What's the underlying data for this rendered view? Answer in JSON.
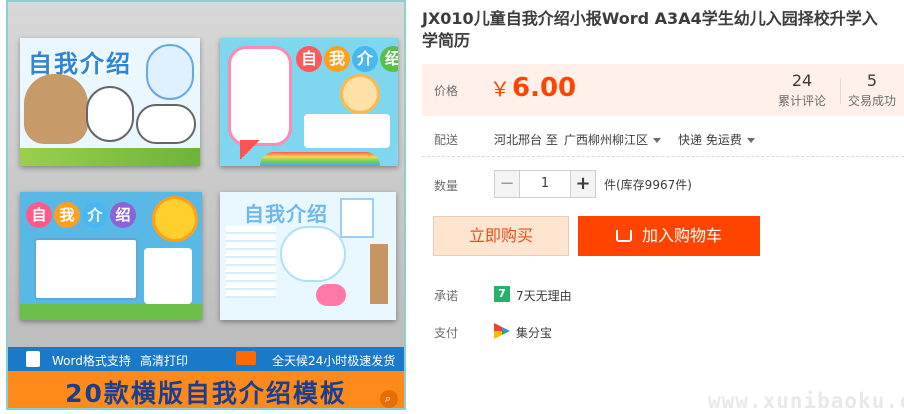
{
  "gallery": {
    "card1_title": "自我介绍",
    "card2_title_chars": [
      "自",
      "我",
      "介",
      "绍"
    ],
    "card2_title_colors": [
      "#ff5a5a",
      "#ff9f1a",
      "#49b8f0",
      "#58c04a"
    ],
    "card3_title_chars": [
      "自",
      "我",
      "介",
      "绍"
    ],
    "card3_title_colors": [
      "#ff5a8a",
      "#ff9f1a",
      "#49b8f0",
      "#8c64d8"
    ],
    "card4_title": "自我介绍",
    "strip_word": "Word格式支持",
    "strip_print": "高清打印",
    "strip_delivery": "全天候24小时极速发货",
    "banner": "20款横版自我介绍模板",
    "icons": [
      "word-doc-icon",
      "delivery-truck-icon",
      "zoom-icon"
    ]
  },
  "product": {
    "title": "JX010儿童自我介绍小报Word A3A4学生幼儿入园择校升学入学简历"
  },
  "price": {
    "label": "价格",
    "currency": "￥",
    "amount": "6.00",
    "reviews_count": "24",
    "reviews_label": "累计评论",
    "deals_count": "5",
    "deals_label": "交易成功"
  },
  "delivery": {
    "label": "配送",
    "from": "河北邢台 至",
    "to": "广西柳州柳江区",
    "method": "快递 免运费"
  },
  "quantity": {
    "label": "数量",
    "minus": "−",
    "value": "1",
    "plus": "+",
    "stock": "件(库存9967件)"
  },
  "actions": {
    "buy_now": "立即购买",
    "add_to_cart": "加入购物车"
  },
  "promise": {
    "label": "承诺",
    "badge": "7",
    "text": "7天无理由"
  },
  "payment": {
    "label": "支付",
    "text": "集分宝"
  },
  "watermark": "www.xunibaoku.com",
  "colors": {
    "accent": "#ff4400",
    "price_bg": "#fff1ea",
    "buy_now_bg": "#ffe4d0",
    "banner_orange": "#ff8a1c",
    "strip_blue": "#1b79c9",
    "promise_green": "#27b26b"
  }
}
